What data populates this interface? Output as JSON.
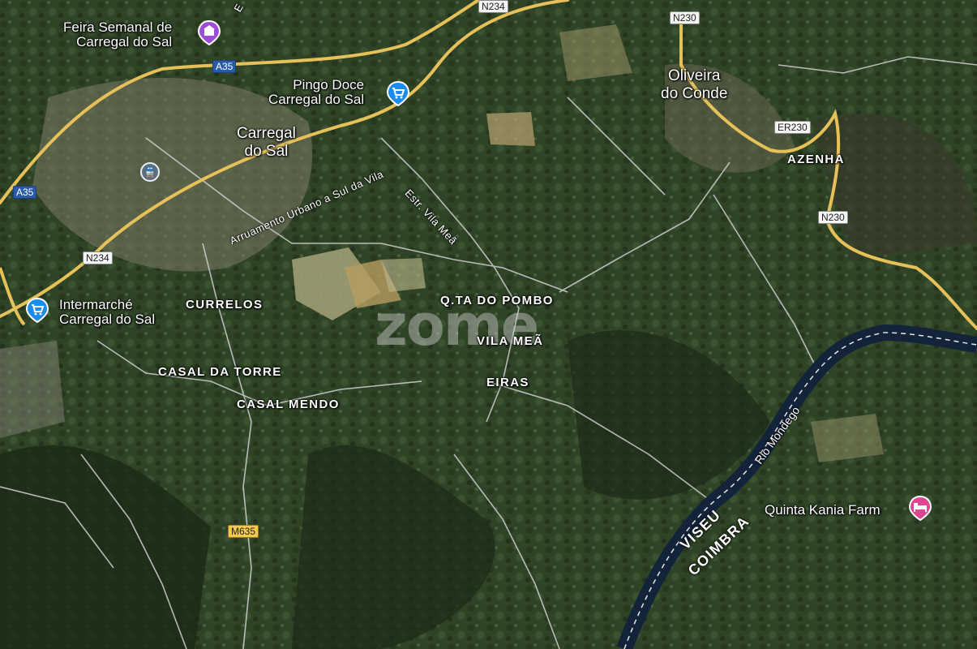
{
  "map": {
    "type": "satellite",
    "colors": {
      "forest_dark": "#1f2e1a",
      "forest": "#34492b",
      "field": "#8c8a62",
      "major_road": "#e6c15a",
      "minor_road": "#c9c9c9",
      "river": "#13233a",
      "shop_pin": "#1a8cf0",
      "event_pin": "#9c4ed6",
      "hotel_pin": "#e0458f"
    },
    "places": [
      {
        "name": "Carregal\ndo Sal",
        "size": "town"
      },
      {
        "name": "Oliveira\ndo Conde",
        "size": "town"
      },
      {
        "name": "AZENHA",
        "size": "village"
      },
      {
        "name": "CURRELOS",
        "size": "village"
      },
      {
        "name": "CASAL DA TORRE",
        "size": "village"
      },
      {
        "name": "CASAL MENDO",
        "size": "village"
      },
      {
        "name": "Q.TA DO POMBO",
        "size": "village"
      },
      {
        "name": "VILA MEÃ",
        "size": "village"
      },
      {
        "name": "EIRAS",
        "size": "village"
      }
    ],
    "pois": [
      {
        "name": "Feira Semanal de\nCarregal do Sal",
        "icon": "event-venue-icon"
      },
      {
        "name": "Pingo Doce\nCarregal do Sal",
        "icon": "shopping-cart-icon"
      },
      {
        "name": "Intermarché\nCarregal do Sal",
        "icon": "shopping-cart-icon"
      },
      {
        "name": "Quinta Kania Farm",
        "icon": "hotel-bed-icon"
      }
    ],
    "road_shields": {
      "a35_top": "A35",
      "a35_left": "A35",
      "n234_top": "N234",
      "n234_left": "N234",
      "n230_top": "N230",
      "er230": "ER230",
      "n230_right": "N230",
      "m635": "M635",
      "road_top_partial": "E"
    },
    "street_labels": {
      "arruamento": "Arruamento Urbano a Sul da Vila",
      "estrada": "Estr. Vila Meã"
    },
    "river_label": "Rio Mondego",
    "border_labels": {
      "north": "VISEU",
      "south": "COIMBRA"
    },
    "watermark": "zome"
  }
}
